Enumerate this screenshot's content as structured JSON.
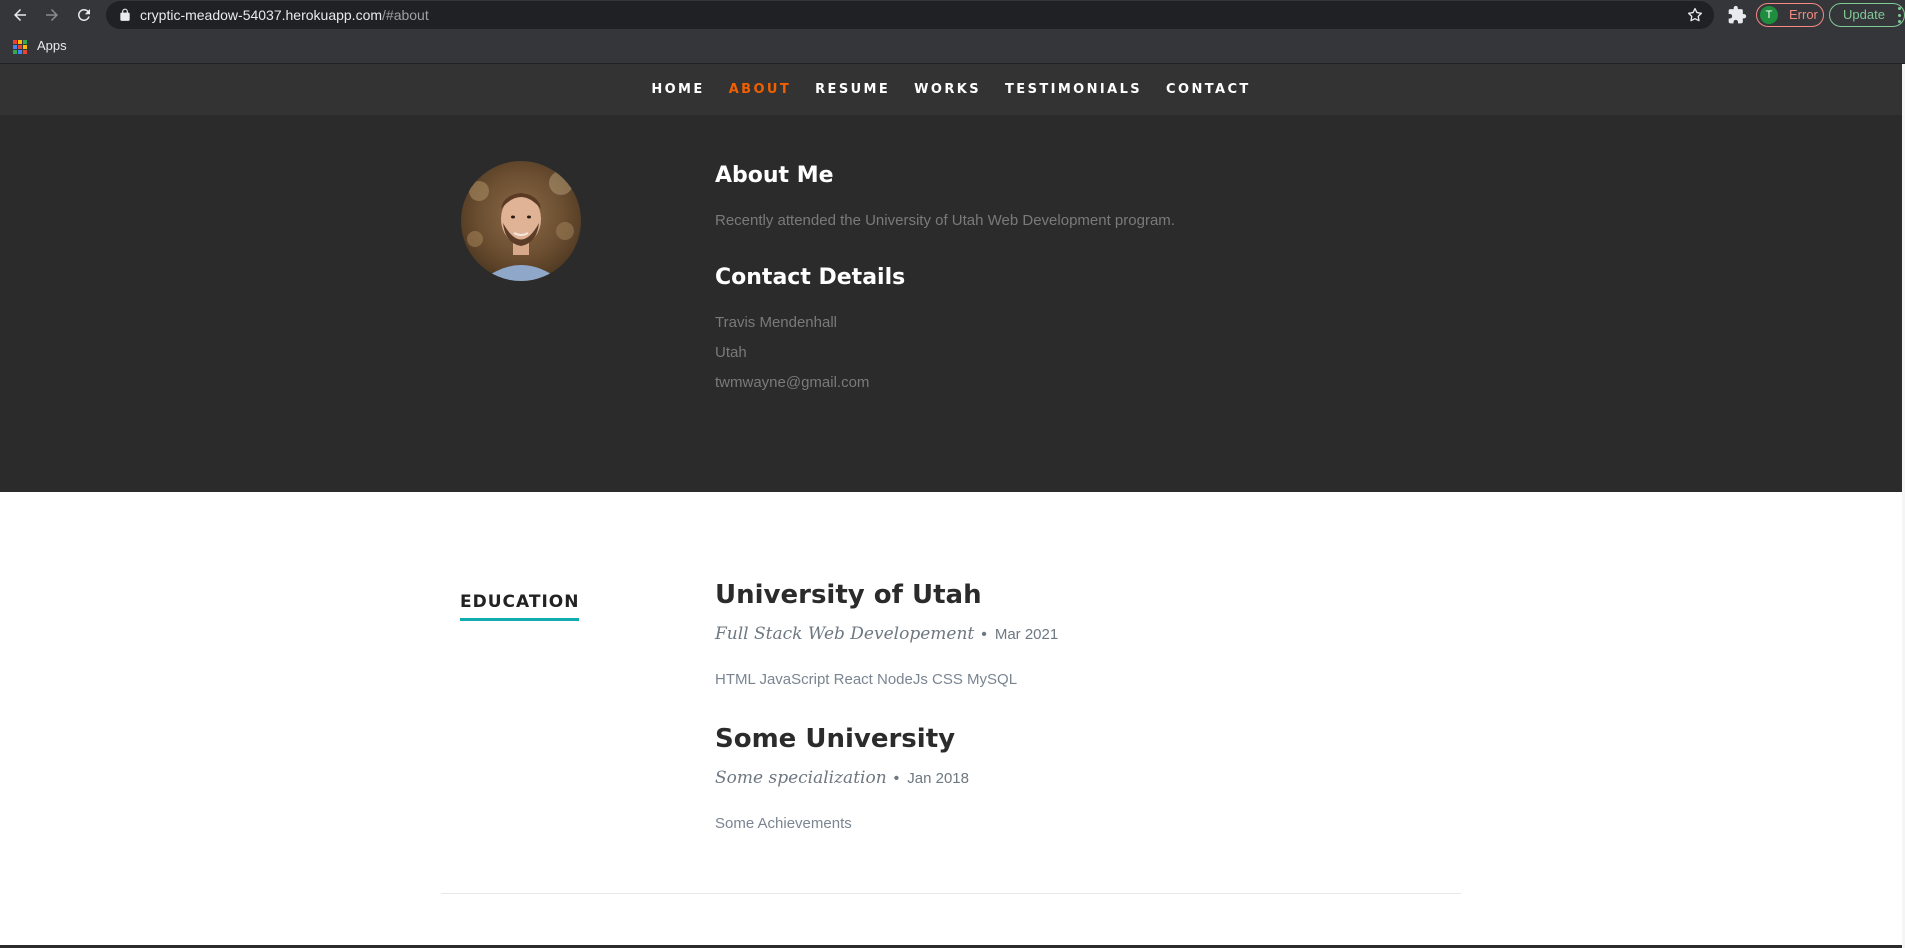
{
  "browser": {
    "url_host": "cryptic-meadow-54037.herokuapp.com",
    "url_path": "/#about",
    "profile_initial": "T",
    "profile_status": "Error",
    "update_label": "Update",
    "bookmarks": {
      "apps_label": "Apps"
    }
  },
  "nav": {
    "items": [
      {
        "label": "HOME",
        "active": false
      },
      {
        "label": "ABOUT",
        "active": true
      },
      {
        "label": "RESUME",
        "active": false
      },
      {
        "label": "WORKS",
        "active": false
      },
      {
        "label": "TESTIMONIALS",
        "active": false
      },
      {
        "label": "CONTACT",
        "active": false
      }
    ],
    "active_color": "#f06000"
  },
  "about": {
    "heading": "About Me",
    "bio": "Recently attended the University of Utah Web Development program.",
    "contact_heading": "Contact Details",
    "contact": {
      "name": "Travis Mendenhall",
      "location": "Utah",
      "email": "twmwayne@gmail.com"
    }
  },
  "education": {
    "section_label": "EDUCATION",
    "accent_color": "#11abb0",
    "entries": [
      {
        "school": "University of Utah",
        "degree": "Full Stack Web Developement",
        "date": "Mar 2021",
        "description": "HTML JavaScript React NodeJs CSS MySQL"
      },
      {
        "school": "Some University",
        "degree": "Some specialization",
        "date": "Jan 2018",
        "description": "Some Achievements"
      }
    ]
  }
}
